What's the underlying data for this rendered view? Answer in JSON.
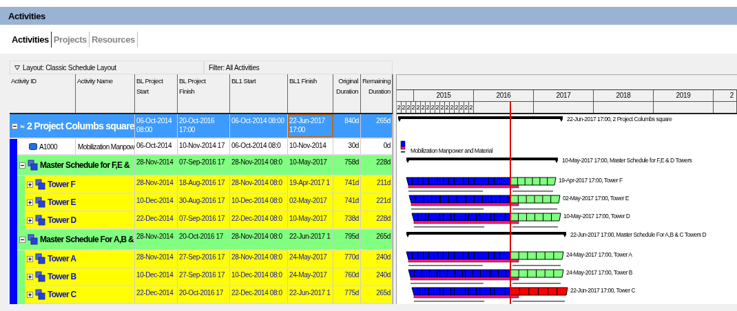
{
  "window": {
    "title": "Activities"
  },
  "tabs": [
    {
      "label": "Activities",
      "selected": true
    },
    {
      "label": "Projects",
      "selected": false
    },
    {
      "label": "Resources",
      "selected": false
    }
  ],
  "layout_bar": {
    "layout": "Layout: Classic Schedule Layout",
    "filter": "Filter: All Activities"
  },
  "table": {
    "columns": [
      "Activity ID",
      "Activity Name",
      "BL Project Start",
      "BL Project Finish",
      "BL1 Start",
      "BL1 Finish",
      "Original Duration",
      "Remaining Duration"
    ],
    "rows": [
      {
        "kind": "project",
        "expanded": true,
        "cells": [
          "2 Project Columbs square",
          "",
          "06-Oct-2014 08:00",
          "20-Oct-2016 17:00",
          "06-Oct-2014 08:00",
          "22-Jun-2017 17:00",
          "840d",
          "265d"
        ],
        "gantt_label": "22-Jun-2017 17:00, 2 Project Columbs square",
        "children": [
          {
            "kind": "activity",
            "cells": [
              "A1000",
              "Mobilization Manpow",
              "06-Oct-2014",
              "10-Nov-2014 17",
              "06-Oct-2014 08:0",
              "10-Nov-2014",
              "30d",
              "0d"
            ],
            "gantt_label": "Mobilization Manpower and Material"
          },
          {
            "kind": "wbs-group",
            "expanded": true,
            "cells": [
              "Master Schedule for F,E &",
              "",
              "28-Nov-2014",
              "07-Sep-2016 17",
              "28-Nov-2014 08:0",
              "10-May-2017",
              "758d",
              "228d"
            ],
            "gantt_label": "10-May-2017 17:00, Master Schedule for F,E & D Towers",
            "children": [
              {
                "kind": "wbs",
                "expanded": false,
                "critical": false,
                "cells": [
                  "Tower F",
                  "",
                  "28-Nov-2014",
                  "18-Aug-2016 17",
                  "28-Nov-2014 08:0",
                  "19-Apr-2017 1",
                  "741d",
                  "211d"
                ],
                "gantt_label": "19-Apr-2017 17:00, Tower F"
              },
              {
                "kind": "wbs",
                "expanded": false,
                "critical": false,
                "cells": [
                  "Tower E",
                  "",
                  "10-Dec-2014",
                  "30-Aug-2016 17",
                  "10-Dec-2014 08:0",
                  "02-May-2017",
                  "741d",
                  "221d"
                ],
                "gantt_label": "02-May-2017 17:00, Tower E"
              },
              {
                "kind": "wbs",
                "expanded": false,
                "critical": false,
                "cells": [
                  "Tower D",
                  "",
                  "22-Dec-2014",
                  "07-Sep-2016 17",
                  "22-Dec-2014 08:0",
                  "10-May-2017",
                  "738d",
                  "228d"
                ],
                "gantt_label": "10-May-2017 17:00, Tower D"
              }
            ]
          },
          {
            "kind": "wbs-group",
            "expanded": true,
            "cells": [
              "Master Schedule For A,B &",
              "",
              "28-Nov-2014",
              "20-Oct-2016 17",
              "28-Nov-2014 08:0",
              "22-Jun-2017 1",
              "795d",
              "265d"
            ],
            "gantt_label": "22-Jun-2017 17:00, Master Schedule For A,B & C Towers D",
            "children": [
              {
                "kind": "wbs",
                "expanded": false,
                "critical": false,
                "cells": [
                  "Tower A",
                  "",
                  "28-Nov-2014",
                  "27-Sep-2016 17",
                  "28-Nov-2014 08:0",
                  "24-May-2017",
                  "770d",
                  "240d"
                ],
                "gantt_label": "24-May-2017 17:00, Tower A"
              },
              {
                "kind": "wbs",
                "expanded": false,
                "critical": false,
                "cells": [
                  "Tower B",
                  "",
                  "10-Dec-2014",
                  "27-Sep-2016 17",
                  "10-Dec-2014 08:0",
                  "24-May-2017",
                  "760d",
                  "240d"
                ],
                "gantt_label": "24-May-2017 17:00, Tower B"
              },
              {
                "kind": "wbs",
                "expanded": false,
                "critical": true,
                "cells": [
                  "Tower C",
                  "",
                  "22-Dec-2014",
                  "20-Oct-2016 17",
                  "22-Dec-2014 08:0",
                  "22-Jun-2017 1",
                  "775d",
                  "265d"
                ],
                "gantt_label": "22-Jun-2017 17:00, Tower C"
              }
            ]
          }
        ]
      }
    ]
  },
  "gantt": {
    "years": [
      "2015",
      "2016",
      "2017",
      "2018",
      "2019",
      "2"
    ],
    "periods": [
      "2",
      "2",
      "2",
      "2",
      "2",
      "2",
      "2",
      "2",
      "2",
      "2",
      "2",
      "2",
      "2",
      "2",
      "2",
      "2"
    ]
  }
}
